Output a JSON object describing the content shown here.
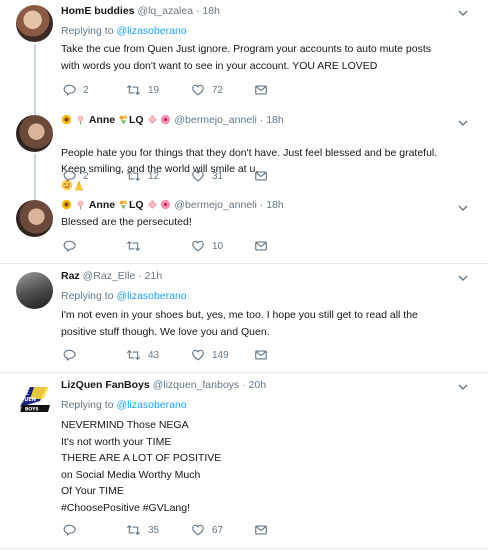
{
  "tweets": [
    {
      "name": "HomE buddies",
      "handle": "@lq_azalea",
      "time": "18h",
      "replying_label": "Replying to",
      "replying_to": "@lizasoberano",
      "text": "Take the cue from Quen Just ignore. Program your accounts to auto mute posts\nwith words you don't want to see in your account. YOU ARE LOVED",
      "replies": "2",
      "retweets": "19",
      "likes": "72"
    },
    {
      "name_pre": "",
      "name": "Anne",
      "name_post": "LQ",
      "handle": "@bermejo_anneli",
      "time": "18h",
      "text": "People hate you for things that they don't have. Just feel blessed and be grateful.\nKeep smiling, and the world will smile at u.",
      "replies": "2",
      "retweets": "12",
      "likes": "31"
    },
    {
      "name": "Anne",
      "name_post": "LQ",
      "handle": "@bermejo_anneli",
      "time": "18h",
      "text": "Blessed are the persecuted!",
      "replies": "",
      "retweets": "",
      "likes": "10"
    },
    {
      "name": "Raz",
      "handle": "@Raz_Elle",
      "time": "21h",
      "replying_label": "Replying to",
      "replying_to": "@lizasoberano",
      "text": "I'm not even in your shoes but, yes, me too. I hope you still get to read all the\npositive stuff though. We love you and Quen.",
      "replies": "",
      "retweets": "43",
      "likes": "149"
    },
    {
      "name": "LizQuen FanBoys",
      "handle": "@lizquen_fanboys",
      "time": "20h",
      "replying_label": "Replying to",
      "replying_to": "@lizasoberano",
      "text": "NEVERMIND Those NEGA\nIt's not worth your TIME\nTHERE ARE A LOT OF POSITIVE\non Social Media Worthy Much\nOf Your TIME\n#ChoosePositive #GVLang!",
      "replies": "",
      "retweets": "35",
      "likes": "67",
      "avatar_logo": "LIZQUEN FAN BOYS"
    }
  ],
  "colors": {
    "text": "#14171a",
    "muted": "#657786",
    "link": "#1da1f2",
    "border": "#e6ecf0",
    "thread_line": "#ccd6dd"
  },
  "icons": [
    "reply-icon",
    "retweet-icon",
    "like-icon",
    "message-icon",
    "chevron-down-icon"
  ]
}
